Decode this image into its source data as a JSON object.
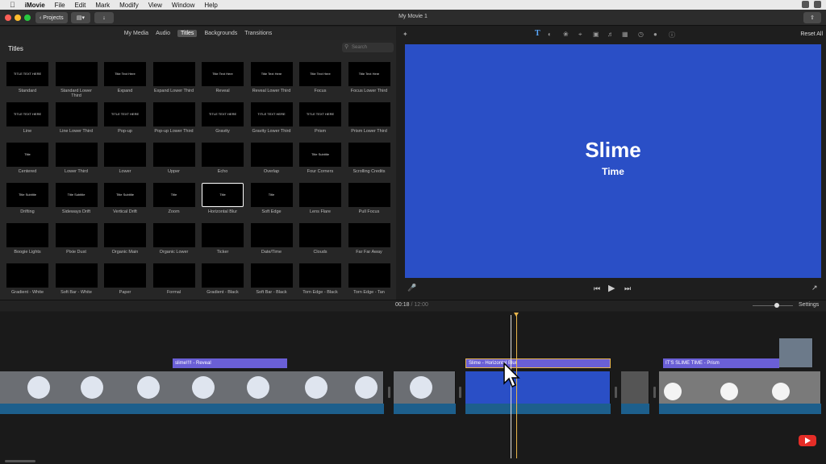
{
  "menubar": {
    "apple": "",
    "app_name": "iMovie",
    "items": [
      "File",
      "Edit",
      "Mark",
      "Modify",
      "View",
      "Window",
      "Help"
    ]
  },
  "toolbar": {
    "projects_label": "Projects",
    "window_title": "My Movie 1"
  },
  "browser": {
    "tabs": [
      "My Media",
      "Audio",
      "Titles",
      "Backgrounds",
      "Transitions"
    ],
    "active_tab": "Titles",
    "header": "Titles",
    "search_placeholder": "Search",
    "tiles": [
      {
        "name": "Standard",
        "thumb": "TITLE TEXT HERE"
      },
      {
        "name": "Standard Lower Third",
        "thumb": ""
      },
      {
        "name": "Expand",
        "thumb": "Title Text Here"
      },
      {
        "name": "Expand Lower Third",
        "thumb": ""
      },
      {
        "name": "Reveal",
        "thumb": "Title Text Here"
      },
      {
        "name": "Reveal Lower Third",
        "thumb": "Title Text Here"
      },
      {
        "name": "Focus",
        "thumb": "Title Text Here"
      },
      {
        "name": "Focus Lower Third",
        "thumb": "Title Text Here"
      },
      {
        "name": "Line",
        "thumb": "TITLE TEXT HERE"
      },
      {
        "name": "Line Lower Third",
        "thumb": ""
      },
      {
        "name": "Pop-up",
        "thumb": "TITLE TEXT HERE"
      },
      {
        "name": "Pop-up Lower Third",
        "thumb": ""
      },
      {
        "name": "Gravity",
        "thumb": "TITLE TEXT HERE"
      },
      {
        "name": "Gravity Lower Third",
        "thumb": "TITLE TEXT HERE"
      },
      {
        "name": "Prism",
        "thumb": "TITLE TEXT HERE"
      },
      {
        "name": "Prism Lower Third",
        "thumb": ""
      },
      {
        "name": "Centered",
        "thumb": "Title"
      },
      {
        "name": "Lower Third",
        "thumb": ""
      },
      {
        "name": "Lower",
        "thumb": ""
      },
      {
        "name": "Upper",
        "thumb": ""
      },
      {
        "name": "Echo",
        "thumb": ""
      },
      {
        "name": "Overlap",
        "thumb": ""
      },
      {
        "name": "Four Corners",
        "thumb": "Title Subtitle"
      },
      {
        "name": "Scrolling Credits",
        "thumb": ""
      },
      {
        "name": "Drifting",
        "thumb": "Title Subtitle"
      },
      {
        "name": "Sideways Drift",
        "thumb": "Title Subtitle"
      },
      {
        "name": "Vertical Drift",
        "thumb": "Title Subtitle"
      },
      {
        "name": "Zoom",
        "thumb": "Title"
      },
      {
        "name": "Horizontal Blur",
        "thumb": "Title"
      },
      {
        "name": "Soft Edge",
        "thumb": "Title"
      },
      {
        "name": "Lens Flare",
        "thumb": ""
      },
      {
        "name": "Pull Focus",
        "thumb": ""
      },
      {
        "name": "Boogie Lights",
        "thumb": ""
      },
      {
        "name": "Pixie Dust",
        "thumb": ""
      },
      {
        "name": "Organic Main",
        "thumb": ""
      },
      {
        "name": "Organic Lower",
        "thumb": ""
      },
      {
        "name": "Ticker",
        "thumb": ""
      },
      {
        "name": "Date/Time",
        "thumb": ""
      },
      {
        "name": "Clouds",
        "thumb": ""
      },
      {
        "name": "Far Far Away",
        "thumb": ""
      },
      {
        "name": "Gradient - White",
        "thumb": ""
      },
      {
        "name": "Soft Bar - White",
        "thumb": ""
      },
      {
        "name": "Paper",
        "thumb": ""
      },
      {
        "name": "Formal",
        "thumb": ""
      },
      {
        "name": "Gradient - Black",
        "thumb": ""
      },
      {
        "name": "Soft Bar - Black",
        "thumb": ""
      },
      {
        "name": "Torn Edge - Black",
        "thumb": ""
      },
      {
        "name": "Torn Edge - Tan",
        "thumb": ""
      }
    ]
  },
  "viewer": {
    "reset_label": "Reset All",
    "title_main": "Slime",
    "title_sub": "Time"
  },
  "timeline": {
    "current_time": "00:18",
    "separator": "/",
    "total_time": "12:00",
    "settings_label": "Settings",
    "title_clips": [
      "slime!!!! - Reveal",
      "Slime - Horizontal Blur",
      "IT'S SLIME TIME - Prism"
    ]
  },
  "colors": {
    "preview_bg": "#2a4fc6",
    "title_clip": "#6a5fd6",
    "audio": "#1d5f8c",
    "playhead": "#e9b64c"
  }
}
